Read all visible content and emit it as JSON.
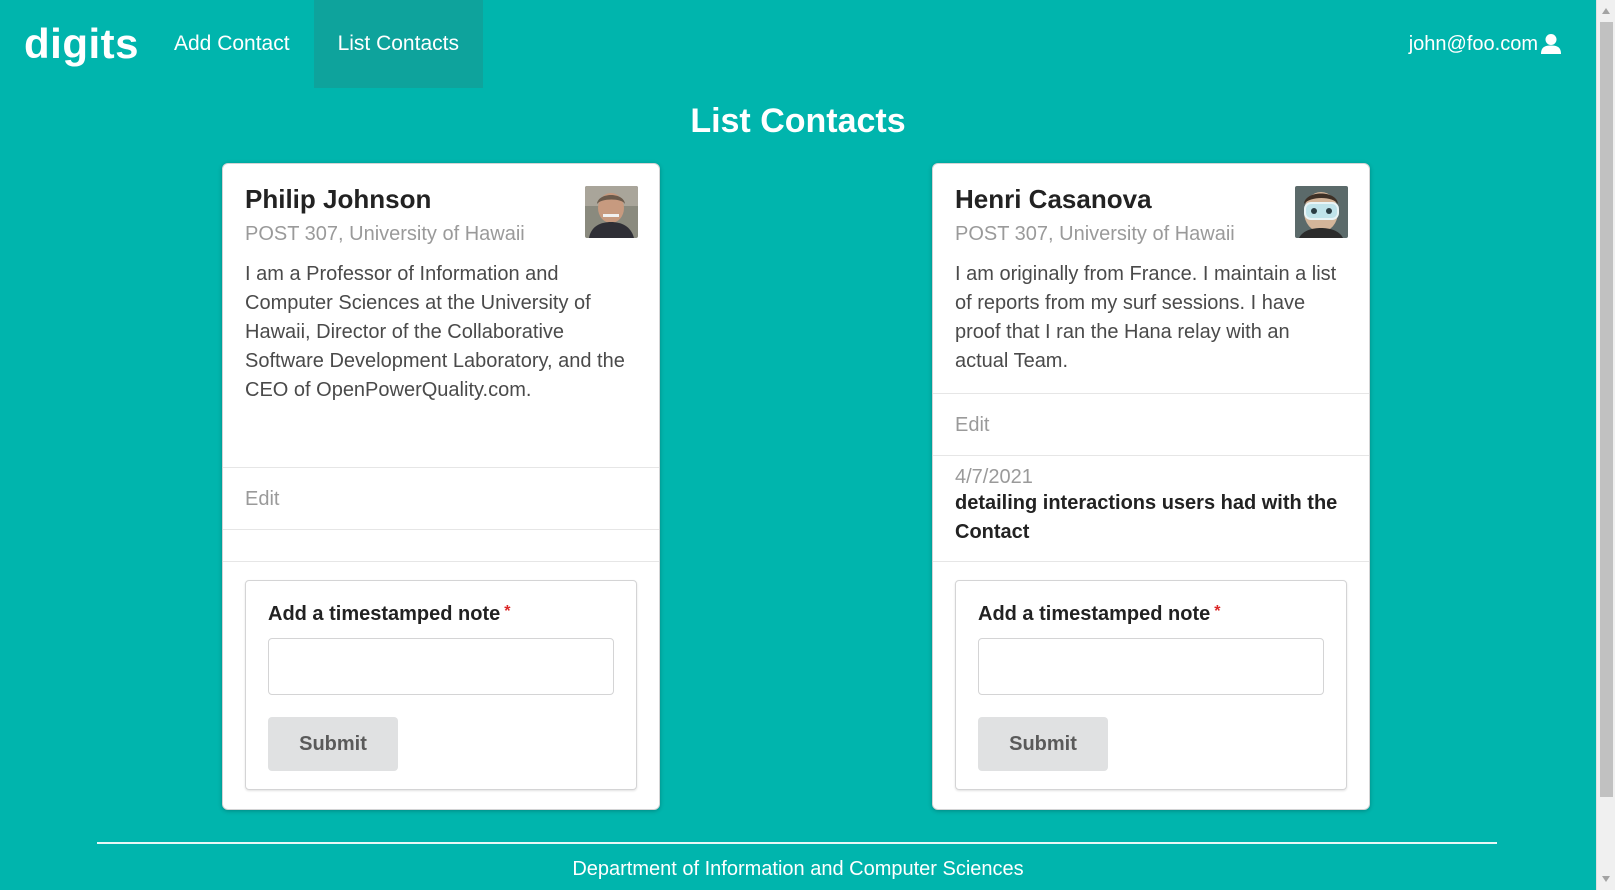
{
  "nav": {
    "brand": "digits",
    "items": [
      {
        "label": "Add Contact",
        "active": false
      },
      {
        "label": "List Contacts",
        "active": true
      }
    ],
    "user": "john@foo.com",
    "user_icon": "user-icon"
  },
  "page": {
    "title": "List Contacts"
  },
  "contacts": [
    {
      "name": "Philip Johnson",
      "address": "POST 307, University of Hawaii",
      "description": "I am a Professor of Information and Computer Sciences at the University of Hawaii, Director of the Collaborative Software Development Laboratory, and the CEO of OpenPowerQuality.com.",
      "edit_label": "Edit",
      "notes": [],
      "form": {
        "label": "Add a timestamped note",
        "required_mark": "*",
        "input_value": "",
        "submit_label": "Submit"
      }
    },
    {
      "name": "Henri Casanova",
      "address": "POST 307, University of Hawaii",
      "description": "I am originally from France. I maintain a list of reports from my surf sessions. I have proof that I ran the Hana relay with an actual Team.",
      "edit_label": "Edit",
      "notes": [
        {
          "date": "4/7/2021",
          "text": "detailing interactions users had with the Contact"
        }
      ],
      "form": {
        "label": "Add a timestamped note",
        "required_mark": "*",
        "input_value": "",
        "submit_label": "Submit"
      }
    }
  ],
  "footer": {
    "text": "Department of Information and Computer Sciences"
  },
  "colors": {
    "primary": "#00b5ad",
    "active_nav": "#0ea39c",
    "required": "#db2828"
  }
}
